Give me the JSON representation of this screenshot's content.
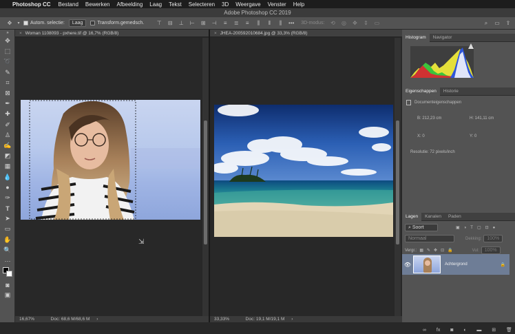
{
  "menubar": {
    "apple": "",
    "app_name": "Photoshop CC",
    "items": [
      "Bestand",
      "Bewerken",
      "Afbeelding",
      "Laag",
      "Tekst",
      "Selecteren",
      "3D",
      "Weergave",
      "Venster",
      "Help"
    ]
  },
  "window_title": "Adobe Photoshop CC 2019",
  "options_bar": {
    "auto_select_label": "Autom. selectie:",
    "auto_select_value": "Laag",
    "transform_label": "Transform.gemedsch.",
    "mode_3d_label": "3D-modus:"
  },
  "documents": [
    {
      "tab": "Woman 1108093 - pxhere.tif @ 16,7% (RGB/8)",
      "zoom": "16,67%",
      "doc_size": "Doc: 68,6 M/68,6 M"
    },
    {
      "tab": "JHEA-200592010684.jpg @ 33,3% (RGB/8)",
      "zoom": "33,33%",
      "doc_size": "Doc: 19,1 M/19,1 M"
    }
  ],
  "histogram_panel": {
    "tabs": [
      "Histogram",
      "Navigator"
    ]
  },
  "properties_panel": {
    "tabs": [
      "Eigenschappen",
      "Historie"
    ],
    "title": "Documenteigenschappen",
    "w": "B: 212,23 cm",
    "h": "H: 141,11 cm",
    "x": "X: 0",
    "y": "Y: 0",
    "resolution": "Resolutie: 72 pixels/inch"
  },
  "layers_panel": {
    "tabs": [
      "Lagen",
      "Kanalen",
      "Paden"
    ],
    "kind_filter": "Soort",
    "blend_mode": "Normaal",
    "opacity_label": "Dekking:",
    "opacity_value": "100%",
    "lock_label": "Vergr.:",
    "fill_label": "Vul:",
    "fill_value": "100%",
    "layers": [
      {
        "name": "Achtergrond"
      }
    ]
  },
  "colors": {
    "accent": "#6e7d96",
    "menubar": "#1d1d1d",
    "panel": "#535353"
  }
}
